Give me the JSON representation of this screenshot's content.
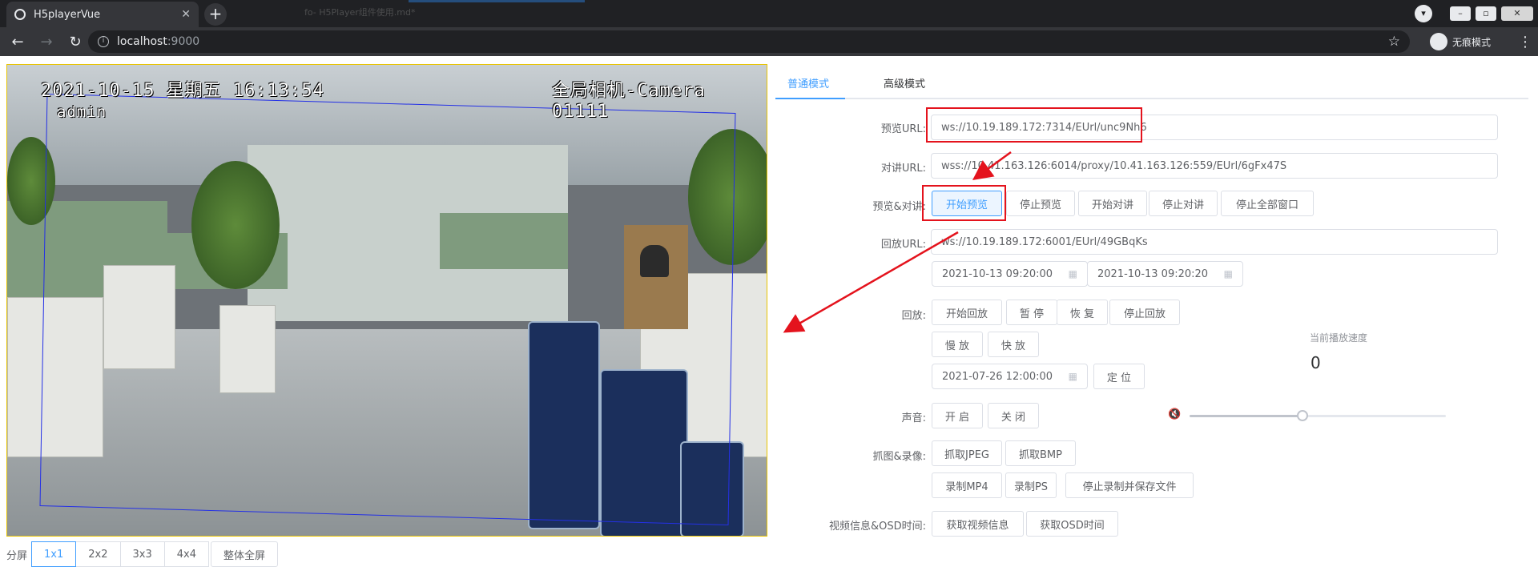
{
  "browser": {
    "tab_title": "H5playerVue",
    "tab_close": "✕",
    "new_tab": "+",
    "background_tab_text": "fo- H5Player组件使用.md*",
    "url_host": "localhost",
    "url_port": ":9000",
    "incognito_label": "无痕模式"
  },
  "video": {
    "osd_datetime": "2021-10-15 星期五 16:13:54",
    "osd_camera": "全局相机-Camera 01111",
    "osd_user": "admin"
  },
  "split": {
    "label": "分屏",
    "options": [
      "1x1",
      "2x2",
      "3x3",
      "4x4"
    ],
    "active_index": 0,
    "fullscreen": "整体全屏"
  },
  "tabs": {
    "normal": "普通模式",
    "advanced": "高级模式"
  },
  "form": {
    "preview_url_label": "预览URL:",
    "preview_url": "ws://10.19.189.172:7314/EUrl/unc9Nh6",
    "talk_url_label": "对讲URL:",
    "talk_url": "wss://10.41.163.126:6014/proxy/10.41.163.126:559/EUrl/6gFx47S",
    "preview_talk_label": "预览&对讲:",
    "btn_start_preview": "开始预览",
    "btn_stop_preview": "停止预览",
    "btn_start_talk": "开始对讲",
    "btn_stop_talk": "停止对讲",
    "btn_stop_all": "停止全部窗口",
    "playback_url_label": "回放URL:",
    "playback_url": "ws://10.19.189.172:6001/EUrl/49GBqKs",
    "start_time": "2021-10-13 09:20:00",
    "end_time": "2021-10-13 09:20:20",
    "playback_label": "回放:",
    "btn_start_playback": "开始回放",
    "btn_pause": "暂 停",
    "btn_resume": "恢 复",
    "btn_stop_playback": "停止回放",
    "btn_slow": "慢 放",
    "btn_fast": "快 放",
    "seek_time": "2021-07-26 12:00:00",
    "btn_seek": "定 位",
    "speed_label": "当前播放速度",
    "speed_value": "0",
    "audio_label": "声音:",
    "btn_audio_on": "开 启",
    "btn_audio_off": "关 闭",
    "volume": 0.44,
    "capture_label": "抓图&录像:",
    "btn_jpeg": "抓取JPEG",
    "btn_bmp": "抓取BMP",
    "btn_mp4": "录制MP4",
    "btn_ps": "录制PS",
    "btn_stop_record": "停止录制并保存文件",
    "info_label": "视频信息&OSD时间:",
    "btn_video_info": "获取视频信息",
    "btn_osd_time": "获取OSD时间"
  },
  "icons": {
    "calendar": "calendar-icon",
    "mute": "mute-icon"
  },
  "colors": {
    "primary": "#409eff",
    "highlight": "#e4131d",
    "osd_box": "#2430e6",
    "video_border": "#e8c400"
  }
}
